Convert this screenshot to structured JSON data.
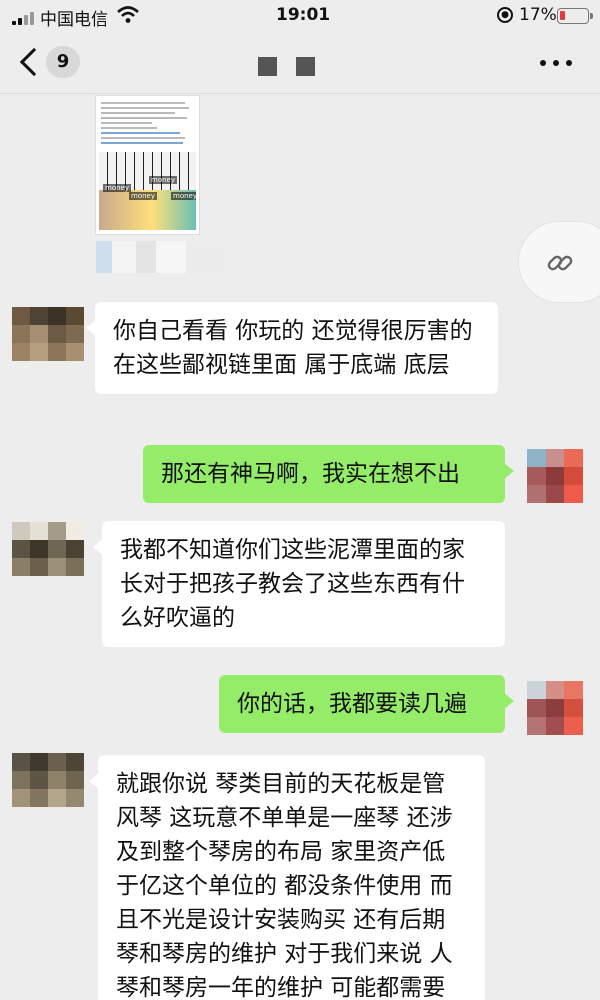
{
  "status_bar": {
    "carrier": "中国电信",
    "time": "19:01",
    "battery_percent": "17%",
    "icons": [
      "signal-icon",
      "wifi-icon",
      "orientation-lock-icon",
      "battery-icon"
    ]
  },
  "nav": {
    "back_icon": "chevron-left-icon",
    "unread_count": "9",
    "title_redacted": true,
    "more_icon": "more-icon"
  },
  "shared_card": {
    "money_labels": [
      "money",
      "money",
      "money",
      "money"
    ],
    "redacted": true
  },
  "link_button": {
    "icon": "link-icon"
  },
  "messages": [
    {
      "side": "left",
      "text": "你自己看看 你玩的 还觉得很厉害的 在这些鄙视链里面 属于底端 底层"
    },
    {
      "side": "right",
      "text": "那还有神马啊，我实在想不出"
    },
    {
      "side": "left",
      "text": "我都不知道你们这些泥潭里面的家长对于把孩子教会了这些东西有什么好吹逼的"
    },
    {
      "side": "right",
      "text": "你的话，我都要读几遍"
    },
    {
      "side": "left",
      "text": "就跟你说 琴类目前的天花板是管风琴 这玩意不单单是一座琴 还涉及到整个琴房的布局 家里资产低于亿这个单位的 都没条件使用 而且不光是设计安装购买 还有后期琴和琴房的维护 对于我们来说 人琴和琴房一年的维护 可能都需要"
    }
  ],
  "colors": {
    "background": "#ededed",
    "bubble_left": "#ffffff",
    "bubble_right": "#95ec69",
    "battery_low": "#e23b3b"
  }
}
